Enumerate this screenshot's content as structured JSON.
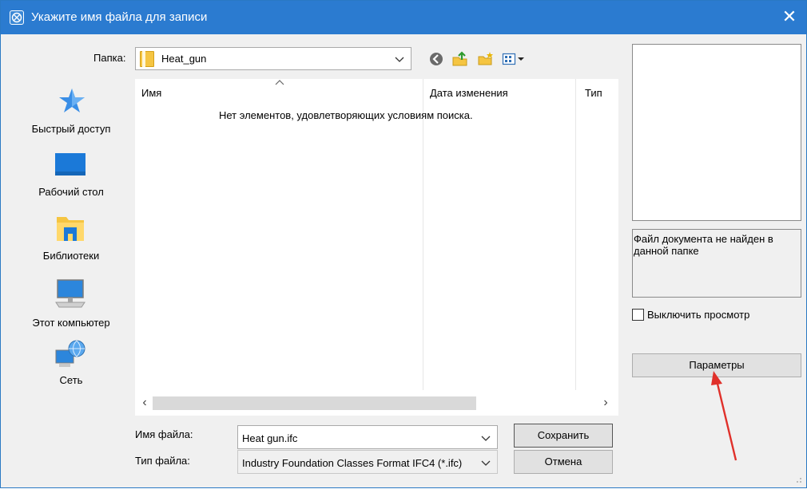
{
  "window": {
    "title": "Укажите имя файла для записи",
    "close_glyph": "✕",
    "accent_color": "#2b7bd0"
  },
  "folder": {
    "label": "Папка:",
    "value": "Heat_gun"
  },
  "toolbar": {
    "icons": [
      "back-icon",
      "up-folder-icon",
      "new-folder-icon",
      "view-menu-icon"
    ]
  },
  "sidebar": {
    "items": [
      {
        "label": "Быстрый доступ",
        "icon": "star-icon"
      },
      {
        "label": "Рабочий стол",
        "icon": "desktop-icon"
      },
      {
        "label": "Библиотеки",
        "icon": "libraries-icon"
      },
      {
        "label": "Этот компьютер",
        "icon": "computer-icon"
      },
      {
        "label": "Сеть",
        "icon": "network-icon"
      }
    ]
  },
  "filelist": {
    "columns": [
      "Имя",
      "Дата изменения",
      "Тип"
    ],
    "empty_message": "Нет элементов, удовлетворяющих условиям поиска."
  },
  "form": {
    "filename_label": "Имя файла:",
    "filename_value": "Heat gun.ifc",
    "filetype_label": "Тип файла:",
    "filetype_value": "Industry Foundation Classes Format IFC4 (*.ifc)",
    "save_label": "Сохранить",
    "cancel_label": "Отмена"
  },
  "preview": {
    "status": "Файл документа не найден в данной папке",
    "disable_label": "Выключить просмотр",
    "disable_checked": false,
    "params_label": "Параметры"
  },
  "annotation": {
    "arrow_color": "#e0302a"
  }
}
